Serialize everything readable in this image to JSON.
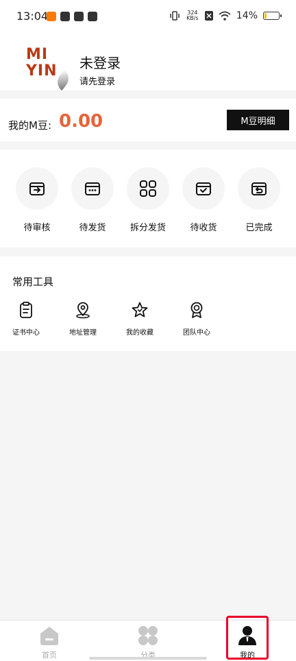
{
  "status_bar": {
    "time": "13:04",
    "net_speed_value": "324",
    "net_speed_unit": "KB/s",
    "battery_text": "14%",
    "battery_level": 0.14
  },
  "profile": {
    "logo_line1": "MI",
    "logo_line2": "YIN",
    "username": "未登录",
    "login_hint": "请先登录"
  },
  "mbean": {
    "label": "我的M豆:",
    "value": "0.00",
    "button_label": "M豆明细"
  },
  "orders": [
    {
      "label": "待审核",
      "icon": "arrow-box-icon"
    },
    {
      "label": "待发货",
      "icon": "dots-box-icon"
    },
    {
      "label": "拆分发货",
      "icon": "grid-icon"
    },
    {
      "label": "待收货",
      "icon": "check-box-icon"
    },
    {
      "label": "已完成",
      "icon": "return-box-icon"
    }
  ],
  "tools": {
    "title": "常用工具",
    "items": [
      {
        "label": "证书中心",
        "icon": "clipboard-icon"
      },
      {
        "label": "地址管理",
        "icon": "location-pin-icon"
      },
      {
        "label": "我的收藏",
        "icon": "star-icon"
      },
      {
        "label": "团队中心",
        "icon": "badge-icon"
      }
    ]
  },
  "tabbar": {
    "items": [
      {
        "label": "首页",
        "icon": "home-icon",
        "active": false
      },
      {
        "label": "分类",
        "icon": "clover-icon",
        "active": false
      },
      {
        "label": "我的",
        "icon": "user-icon",
        "active": true
      }
    ]
  },
  "colors": {
    "accent": "#e8623a",
    "highlight": "#e8002a",
    "logo": "#b93a16"
  }
}
